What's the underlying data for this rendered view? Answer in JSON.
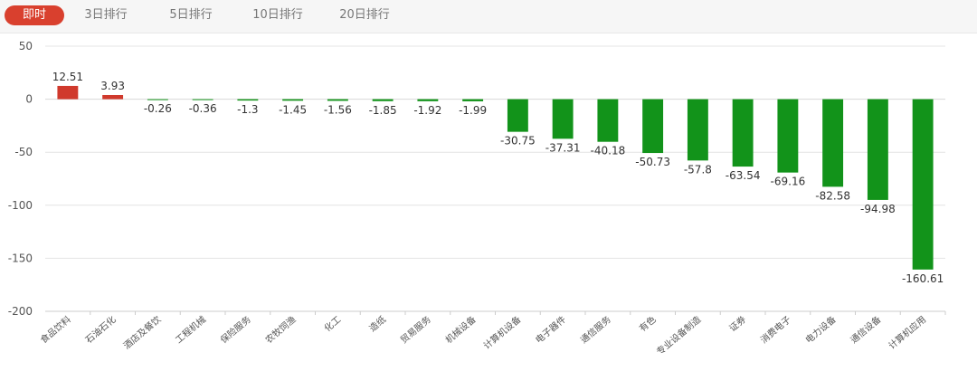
{
  "tabs": [
    {
      "label": "即时",
      "active": true
    },
    {
      "label": "3日排行",
      "active": false
    },
    {
      "label": "5日排行",
      "active": false
    },
    {
      "label": "10日排行",
      "active": false
    },
    {
      "label": "20日排行",
      "active": false
    }
  ],
  "colors": {
    "positive": "#d0392c",
    "negative": "#12931a",
    "active_tab": "#d9402e"
  },
  "chart_data": {
    "type": "bar",
    "title": "",
    "xlabel": "",
    "ylabel": "",
    "ylim": [
      -200,
      50
    ],
    "yticks": [
      50,
      0,
      -50,
      -100,
      -150,
      -200
    ],
    "grid": true,
    "categories": [
      "食品饮料",
      "石油石化",
      "酒店及餐饮",
      "工程机械",
      "保险服务",
      "农牧饲渔",
      "化工",
      "造纸",
      "贸易服务",
      "机械设备",
      "计算机设备",
      "电子器件",
      "通信服务",
      "有色",
      "专业设备制造",
      "证券",
      "消费电子",
      "电力设备",
      "通信设备",
      "计算机应用"
    ],
    "values": [
      12.51,
      3.93,
      -0.26,
      -0.36,
      -1.3,
      -1.45,
      -1.56,
      -1.85,
      -1.92,
      -1.99,
      -30.75,
      -37.31,
      -40.18,
      -50.73,
      -57.8,
      -63.54,
      -69.16,
      -82.58,
      -94.98,
      -160.61
    ],
    "value_labels": [
      "12.51",
      "3.93",
      "-0.26",
      "-0.36",
      "-1.3",
      "-1.45",
      "-1.56",
      "-1.85",
      "-1.92",
      "-1.99",
      "-30.75",
      "-37.31",
      "-40.18",
      "-50.73",
      "-57.8",
      "-63.54",
      "-69.16",
      "-82.58",
      "-94.98",
      "-160.61"
    ]
  }
}
